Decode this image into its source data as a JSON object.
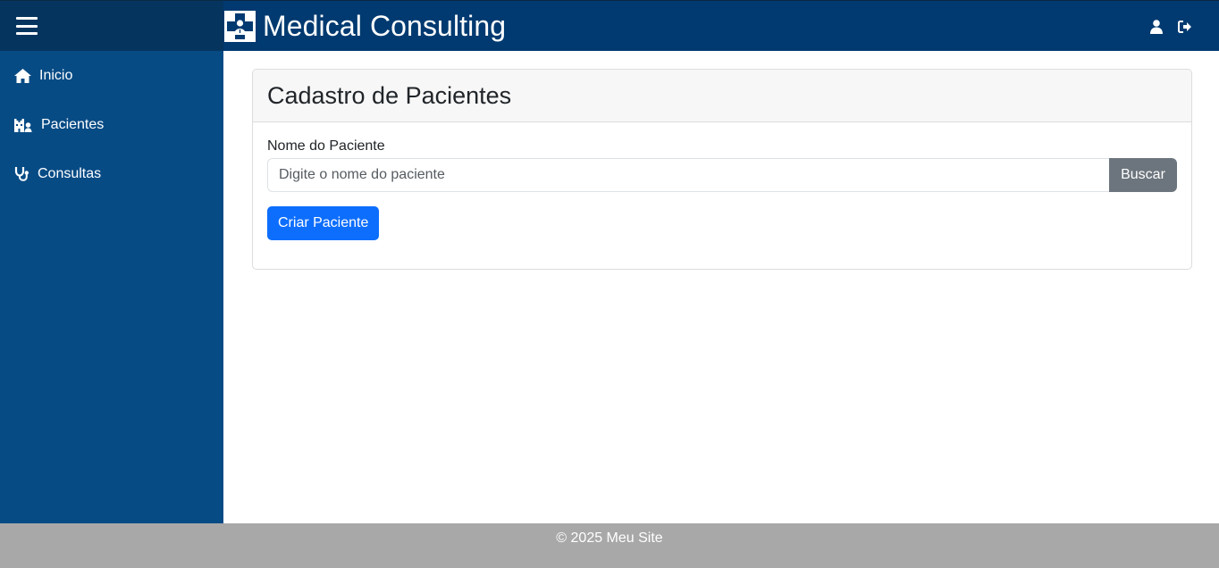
{
  "header": {
    "title": "Medical Consulting",
    "menu_icon": "hamburger-icon",
    "logo_icon": "medical-cross-doctor-icon",
    "user_icon": "user-icon",
    "logout_icon": "sign-out-icon"
  },
  "sidebar": {
    "items": [
      {
        "label": "Inicio",
        "icon": "home-icon"
      },
      {
        "label": "Pacientes",
        "icon": "hospital-user-icon"
      },
      {
        "label": "Consultas",
        "icon": "stethoscope-icon"
      }
    ]
  },
  "main": {
    "card_title": "Cadastro de Pacientes",
    "search": {
      "label": "Nome do Paciente",
      "value": "",
      "placeholder": "Digite o nome do paciente",
      "button_label": "Buscar"
    },
    "create_button_label": "Criar Paciente"
  },
  "footer": {
    "text": "© 2025 Meu Site"
  },
  "colors": {
    "header_bg": "#003a70",
    "sidebar_bg": "#074b85",
    "primary_button": "#0d6efd",
    "secondary_button": "#6c757d",
    "footer_bg": "#a8a8a8"
  }
}
